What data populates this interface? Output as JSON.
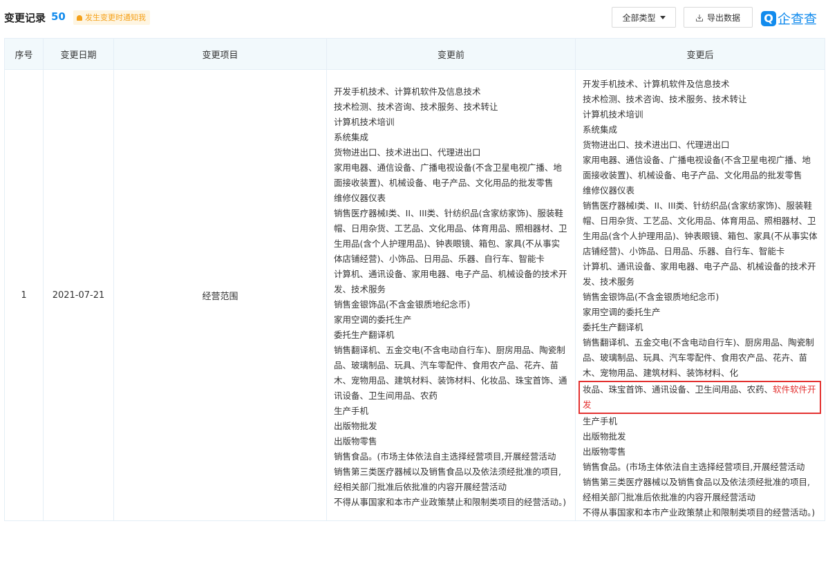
{
  "header": {
    "title": "变更记录",
    "count": "50",
    "notify_label": "发生变更时通知我",
    "type_filter_label": "全部类型",
    "export_label": "导出数据",
    "logo_mark": "Q",
    "logo_text": "企查查"
  },
  "table": {
    "columns": [
      "序号",
      "变更日期",
      "变更项目",
      "变更前",
      "变更后"
    ],
    "row": {
      "index": "1",
      "date": "2021-07-21",
      "item": "经营范围",
      "before": [
        "开发手机技术、计算机软件及信息技术",
        "技术检测、技术咨询、技术服务、技术转让",
        "计算机技术培训",
        "系统集成",
        "货物进出口、技术进出口、代理进出口",
        "家用电器、通信设备、广播电视设备(不含卫星电视广播、地面接收装置)、机械设备、电子产品、文化用品的批发零售",
        "维修仪器仪表",
        "销售医疗器械I类、II、III类、针纺织品(含家纺家饰)、服装鞋帽、日用杂货、工艺品、文化用品、体育用品、照相器材、卫生用品(含个人护理用品)、钟表眼镜、箱包、家具(不从事实体店铺经营)、小饰品、日用品、乐器、自行车、智能卡",
        "计算机、通讯设备、家用电器、电子产品、机械设备的技术开发、技术服务",
        "销售金银饰品(不含金银质地纪念币)",
        "家用空调的委托生产",
        "委托生产翻译机",
        "销售翻译机、五金交电(不含电动自行车)、厨房用品、陶瓷制品、玻璃制品、玩具、汽车零配件、食用农产品、花卉、苗木、宠物用品、建筑材料、装饰材料、化妆品、珠宝首饰、通讯设备、卫生间用品、农药",
        "生产手机",
        "出版物批发",
        "出版物零售",
        "销售食品。(市场主体依法自主选择经营项目,开展经营活动",
        "销售第三类医疗器械以及销售食品以及依法须经批准的项目,经相关部门批准后依批准的内容开展经营活动",
        "不得从事国家和本市产业政策禁止和限制类项目的经营活动。)"
      ],
      "after_top": [
        "开发手机技术、计算机软件及信息技术",
        "技术检测、技术咨询、技术服务、技术转让",
        "计算机技术培训",
        "系统集成",
        "货物进出口、技术进出口、代理进出口",
        "家用电器、通信设备、广播电视设备(不含卫星电视广播、地面接收装置)、机械设备、电子产品、文化用品的批发零售",
        "维修仪器仪表",
        "销售医疗器械I类、II、III类、针纺织品(含家纺家饰)、服装鞋帽、日用杂货、工艺品、文化用品、体育用品、照相器材、卫生用品(含个人护理用品)、钟表眼镜、箱包、家具(不从事实体店铺经营)、小饰品、日用品、乐器、自行车、智能卡",
        "计算机、通讯设备、家用电器、电子产品、机械设备的技术开发、技术服务",
        "销售金银饰品(不含金银质地纪念币)",
        "家用空调的委托生产",
        "委托生产翻译机",
        "销售翻译机、五金交电(不含电动自行车)、厨房用品、陶瓷制品、玻璃制品、玩具、汽车零配件、食用农产品、花卉、苗木、宠物用品、建筑材料、装饰材料、化"
      ],
      "after_highlight_plain": "妆品、珠宝首饰、通讯设备、卫生间用品、农药、",
      "after_highlight_added": "软件软件开发",
      "after_bottom": [
        "生产手机",
        "出版物批发",
        "出版物零售",
        "销售食品。(市场主体依法自主选择经营项目,开展经营活动",
        "销售第三类医疗器械以及销售食品以及依法须经批准的项目,经相关部门批准后依批准的内容开展经营活动",
        "不得从事国家和本市产业政策禁止和限制类项目的经营活动。)"
      ]
    }
  },
  "colors": {
    "accent": "#128bed",
    "highlight": "#e3302f",
    "notify_bg": "#fef5e2",
    "notify_text": "#f5a11a"
  },
  "icons": {
    "notify": "bell-icon",
    "type_filter": "caret-down-icon",
    "export": "download-icon",
    "logo": "qichacha-logo-icon"
  }
}
